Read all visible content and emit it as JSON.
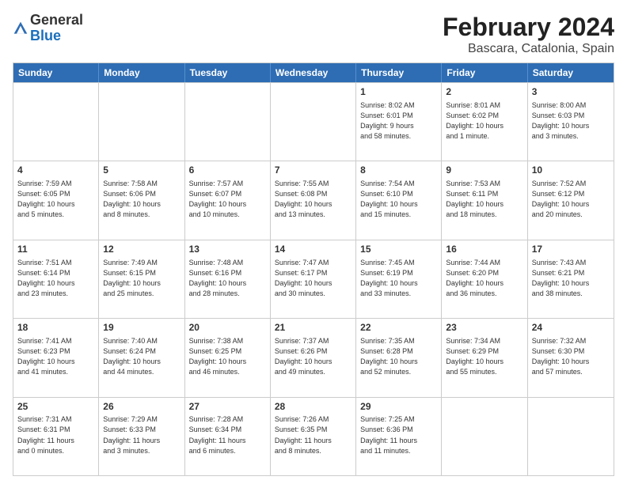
{
  "logo": {
    "general": "General",
    "blue": "Blue"
  },
  "title": "February 2024",
  "subtitle": "Bascara, Catalonia, Spain",
  "days": [
    "Sunday",
    "Monday",
    "Tuesday",
    "Wednesday",
    "Thursday",
    "Friday",
    "Saturday"
  ],
  "weeks": [
    [
      {
        "day": "",
        "info": "",
        "empty": true
      },
      {
        "day": "",
        "info": "",
        "empty": true
      },
      {
        "day": "",
        "info": "",
        "empty": true
      },
      {
        "day": "",
        "info": "",
        "empty": true
      },
      {
        "day": "1",
        "info": "Sunrise: 8:02 AM\nSunset: 6:01 PM\nDaylight: 9 hours\nand 58 minutes.",
        "empty": false
      },
      {
        "day": "2",
        "info": "Sunrise: 8:01 AM\nSunset: 6:02 PM\nDaylight: 10 hours\nand 1 minute.",
        "empty": false
      },
      {
        "day": "3",
        "info": "Sunrise: 8:00 AM\nSunset: 6:03 PM\nDaylight: 10 hours\nand 3 minutes.",
        "empty": false
      }
    ],
    [
      {
        "day": "4",
        "info": "Sunrise: 7:59 AM\nSunset: 6:05 PM\nDaylight: 10 hours\nand 5 minutes.",
        "empty": false
      },
      {
        "day": "5",
        "info": "Sunrise: 7:58 AM\nSunset: 6:06 PM\nDaylight: 10 hours\nand 8 minutes.",
        "empty": false
      },
      {
        "day": "6",
        "info": "Sunrise: 7:57 AM\nSunset: 6:07 PM\nDaylight: 10 hours\nand 10 minutes.",
        "empty": false
      },
      {
        "day": "7",
        "info": "Sunrise: 7:55 AM\nSunset: 6:08 PM\nDaylight: 10 hours\nand 13 minutes.",
        "empty": false
      },
      {
        "day": "8",
        "info": "Sunrise: 7:54 AM\nSunset: 6:10 PM\nDaylight: 10 hours\nand 15 minutes.",
        "empty": false
      },
      {
        "day": "9",
        "info": "Sunrise: 7:53 AM\nSunset: 6:11 PM\nDaylight: 10 hours\nand 18 minutes.",
        "empty": false
      },
      {
        "day": "10",
        "info": "Sunrise: 7:52 AM\nSunset: 6:12 PM\nDaylight: 10 hours\nand 20 minutes.",
        "empty": false
      }
    ],
    [
      {
        "day": "11",
        "info": "Sunrise: 7:51 AM\nSunset: 6:14 PM\nDaylight: 10 hours\nand 23 minutes.",
        "empty": false
      },
      {
        "day": "12",
        "info": "Sunrise: 7:49 AM\nSunset: 6:15 PM\nDaylight: 10 hours\nand 25 minutes.",
        "empty": false
      },
      {
        "day": "13",
        "info": "Sunrise: 7:48 AM\nSunset: 6:16 PM\nDaylight: 10 hours\nand 28 minutes.",
        "empty": false
      },
      {
        "day": "14",
        "info": "Sunrise: 7:47 AM\nSunset: 6:17 PM\nDaylight: 10 hours\nand 30 minutes.",
        "empty": false
      },
      {
        "day": "15",
        "info": "Sunrise: 7:45 AM\nSunset: 6:19 PM\nDaylight: 10 hours\nand 33 minutes.",
        "empty": false
      },
      {
        "day": "16",
        "info": "Sunrise: 7:44 AM\nSunset: 6:20 PM\nDaylight: 10 hours\nand 36 minutes.",
        "empty": false
      },
      {
        "day": "17",
        "info": "Sunrise: 7:43 AM\nSunset: 6:21 PM\nDaylight: 10 hours\nand 38 minutes.",
        "empty": false
      }
    ],
    [
      {
        "day": "18",
        "info": "Sunrise: 7:41 AM\nSunset: 6:23 PM\nDaylight: 10 hours\nand 41 minutes.",
        "empty": false
      },
      {
        "day": "19",
        "info": "Sunrise: 7:40 AM\nSunset: 6:24 PM\nDaylight: 10 hours\nand 44 minutes.",
        "empty": false
      },
      {
        "day": "20",
        "info": "Sunrise: 7:38 AM\nSunset: 6:25 PM\nDaylight: 10 hours\nand 46 minutes.",
        "empty": false
      },
      {
        "day": "21",
        "info": "Sunrise: 7:37 AM\nSunset: 6:26 PM\nDaylight: 10 hours\nand 49 minutes.",
        "empty": false
      },
      {
        "day": "22",
        "info": "Sunrise: 7:35 AM\nSunset: 6:28 PM\nDaylight: 10 hours\nand 52 minutes.",
        "empty": false
      },
      {
        "day": "23",
        "info": "Sunrise: 7:34 AM\nSunset: 6:29 PM\nDaylight: 10 hours\nand 55 minutes.",
        "empty": false
      },
      {
        "day": "24",
        "info": "Sunrise: 7:32 AM\nSunset: 6:30 PM\nDaylight: 10 hours\nand 57 minutes.",
        "empty": false
      }
    ],
    [
      {
        "day": "25",
        "info": "Sunrise: 7:31 AM\nSunset: 6:31 PM\nDaylight: 11 hours\nand 0 minutes.",
        "empty": false
      },
      {
        "day": "26",
        "info": "Sunrise: 7:29 AM\nSunset: 6:33 PM\nDaylight: 11 hours\nand 3 minutes.",
        "empty": false
      },
      {
        "day": "27",
        "info": "Sunrise: 7:28 AM\nSunset: 6:34 PM\nDaylight: 11 hours\nand 6 minutes.",
        "empty": false
      },
      {
        "day": "28",
        "info": "Sunrise: 7:26 AM\nSunset: 6:35 PM\nDaylight: 11 hours\nand 8 minutes.",
        "empty": false
      },
      {
        "day": "29",
        "info": "Sunrise: 7:25 AM\nSunset: 6:36 PM\nDaylight: 11 hours\nand 11 minutes.",
        "empty": false
      },
      {
        "day": "",
        "info": "",
        "empty": true
      },
      {
        "day": "",
        "info": "",
        "empty": true
      }
    ]
  ]
}
